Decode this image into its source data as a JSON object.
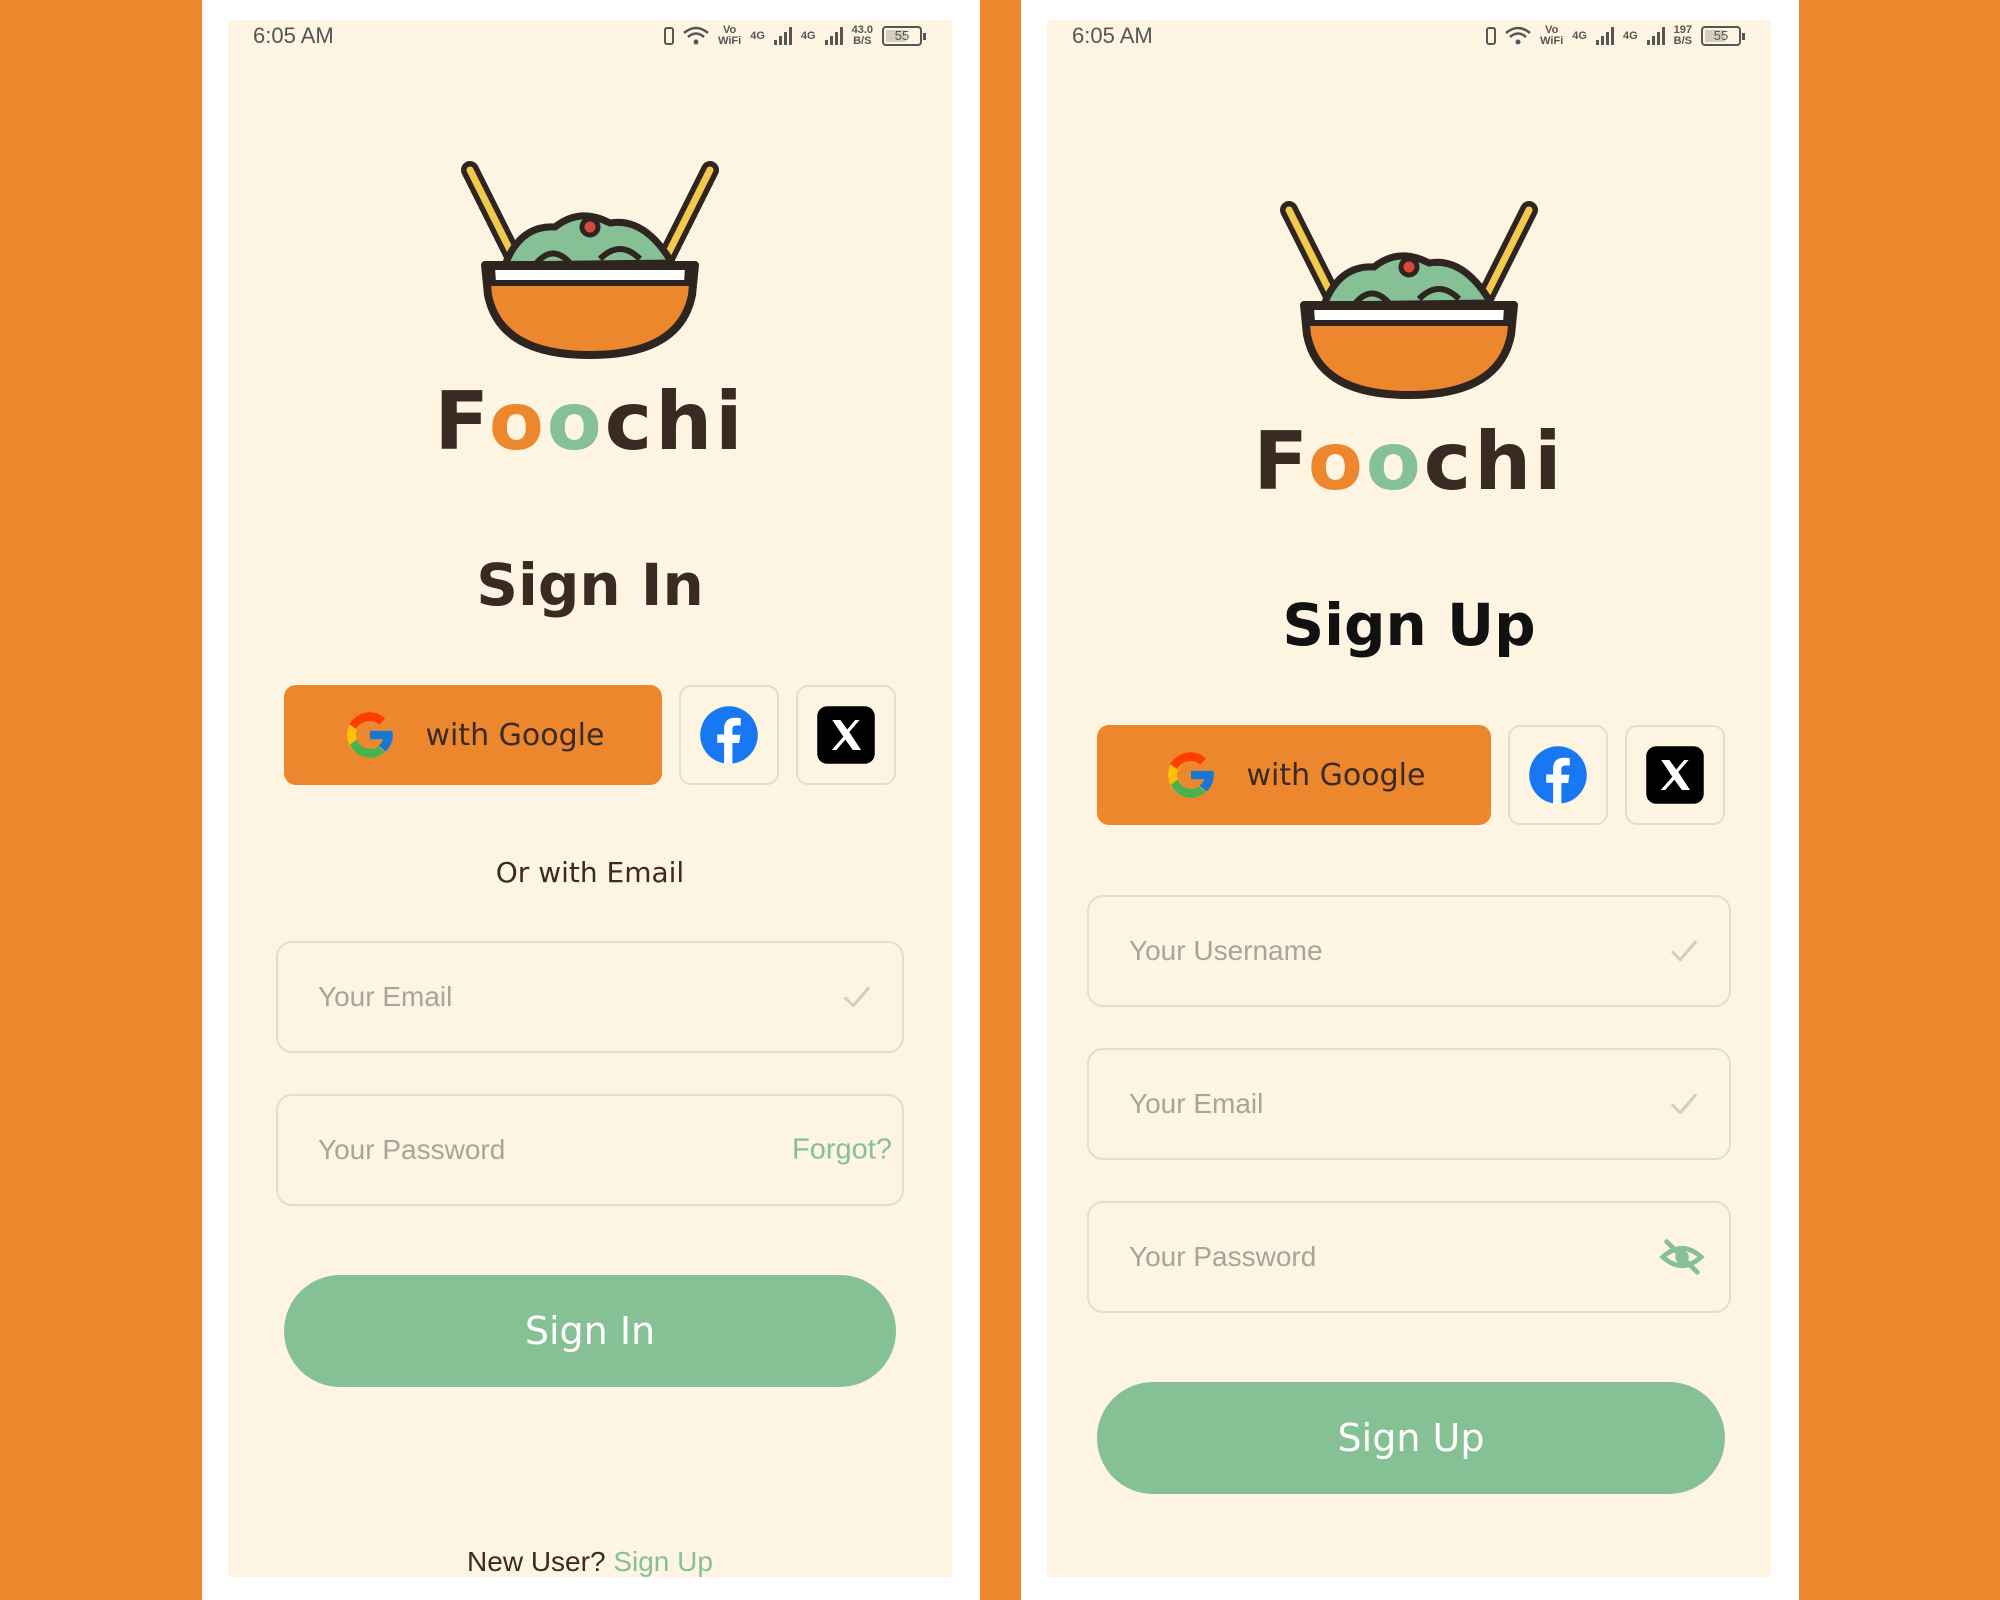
{
  "colors": {
    "background": "#EC872E",
    "screen": "#FEF4E2",
    "accent_orange": "#EC872E",
    "accent_green": "#86C095",
    "text_dark": "#3A2B22"
  },
  "status_bar": {
    "time": "6:05 AM",
    "left_speed_top": "43.0",
    "right_speed_top": "197",
    "speed_unit": "B/S",
    "vo": "Vo",
    "wifi_label": "WiFi",
    "network": "4G",
    "battery": "55"
  },
  "brand": {
    "letters": [
      "F",
      "o",
      "o",
      "c",
      "h",
      "i"
    ]
  },
  "signin": {
    "title": "Sign In",
    "google_label": "with Google",
    "or_text": "Or with Email",
    "email_placeholder": "Your Email",
    "password_placeholder": "Your Password",
    "forgot_label": "Forgot?",
    "submit_label": "Sign In",
    "footer_text": "New User?",
    "footer_link": "Sign Up"
  },
  "signup": {
    "title": "Sign Up",
    "google_label": "with Google",
    "username_placeholder": "Your Username",
    "email_placeholder": "Your Email",
    "password_placeholder": "Your Password",
    "submit_label": "Sign Up"
  },
  "icons": [
    "google-icon",
    "facebook-icon",
    "x-icon",
    "check-icon",
    "eye-off-icon",
    "bowl-logo-icon"
  ]
}
